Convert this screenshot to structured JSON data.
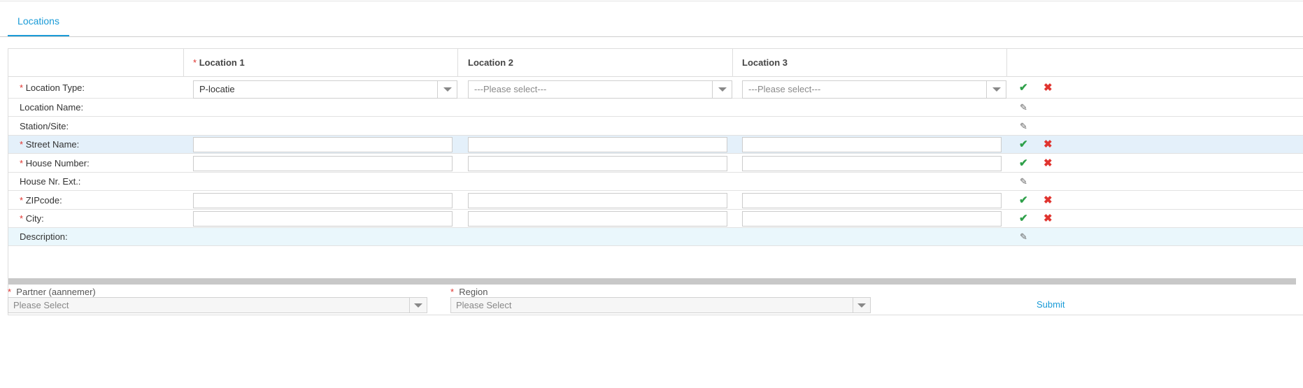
{
  "tabs": [
    {
      "label": "Locations",
      "active": true
    }
  ],
  "table": {
    "columns": [
      {
        "label": "Location 1",
        "required": true
      },
      {
        "label": "Location 2",
        "required": false
      },
      {
        "label": "Location 3",
        "required": false
      }
    ],
    "rows": [
      {
        "label": "Location Type:",
        "required": true,
        "kind": "select",
        "values": [
          "P-locatie",
          "---Please select---",
          "---Please select---"
        ],
        "actions": "confirm"
      },
      {
        "label": "Location Name:",
        "required": false,
        "kind": "text",
        "actions": "edit"
      },
      {
        "label": "Station/Site:",
        "required": false,
        "kind": "text",
        "actions": "edit"
      },
      {
        "label": "Street Name:",
        "required": true,
        "kind": "input",
        "actions": "confirm",
        "highlight": true
      },
      {
        "label": "House Number:",
        "required": true,
        "kind": "input",
        "actions": "confirm"
      },
      {
        "label": "House Nr. Ext.:",
        "required": false,
        "kind": "text",
        "actions": "edit"
      },
      {
        "label": "ZIPcode:",
        "required": true,
        "kind": "input",
        "actions": "confirm"
      },
      {
        "label": "City:",
        "required": true,
        "kind": "input",
        "actions": "confirm"
      },
      {
        "label": "Description:",
        "required": false,
        "kind": "text",
        "actions": "edit",
        "highlight": true
      }
    ],
    "required_mark": "*",
    "icons": {
      "confirm": "check-icon",
      "cancel": "close-icon",
      "edit": "pencil-icon"
    },
    "icon_glyphs": {
      "confirm": "✔",
      "cancel": "✖",
      "edit": "✎"
    }
  },
  "submit_label": "Submit",
  "fields": [
    {
      "label": "Partner (aannemer)",
      "required": true,
      "placeholder": "Please Select"
    },
    {
      "label": "Region",
      "required": true,
      "placeholder": "Please Select"
    }
  ],
  "colors": {
    "accent": "#1a9bd7",
    "required": "#e0342f",
    "confirm": "#2fa04a"
  }
}
